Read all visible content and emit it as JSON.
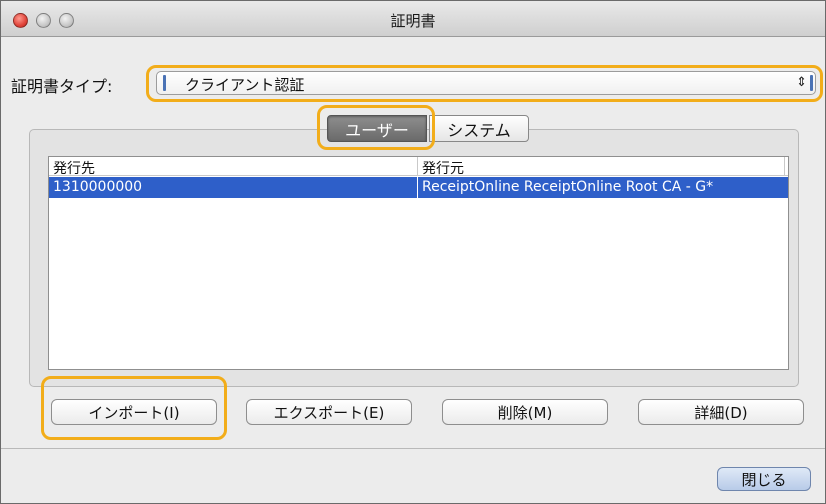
{
  "window": {
    "title": "証明書",
    "controls": [
      "close-icon",
      "minimize-icon",
      "zoom-icon"
    ]
  },
  "certificate_type": {
    "label": "証明書タイプ:",
    "selected": "クライアント認証",
    "arrows_glyph": "⇕"
  },
  "tabs": [
    {
      "label": "ユーザー",
      "selected": true
    },
    {
      "label": "システム",
      "selected": false
    }
  ],
  "table": {
    "columns": [
      "発行先",
      "発行元"
    ],
    "rows": [
      {
        "issued_to": "1310000000",
        "issued_by": "ReceiptOnline ReceiptOnline Root CA - G*",
        "selected": true
      }
    ]
  },
  "buttons": {
    "import": "インポート(I)",
    "export": "エクスポート(E)",
    "delete": "削除(M)",
    "detail": "詳細(D)",
    "close": "閉じる"
  },
  "colors": {
    "highlight": "#f2ad1a",
    "selection": "#2e5fc9",
    "close_red": "#e0443a"
  }
}
